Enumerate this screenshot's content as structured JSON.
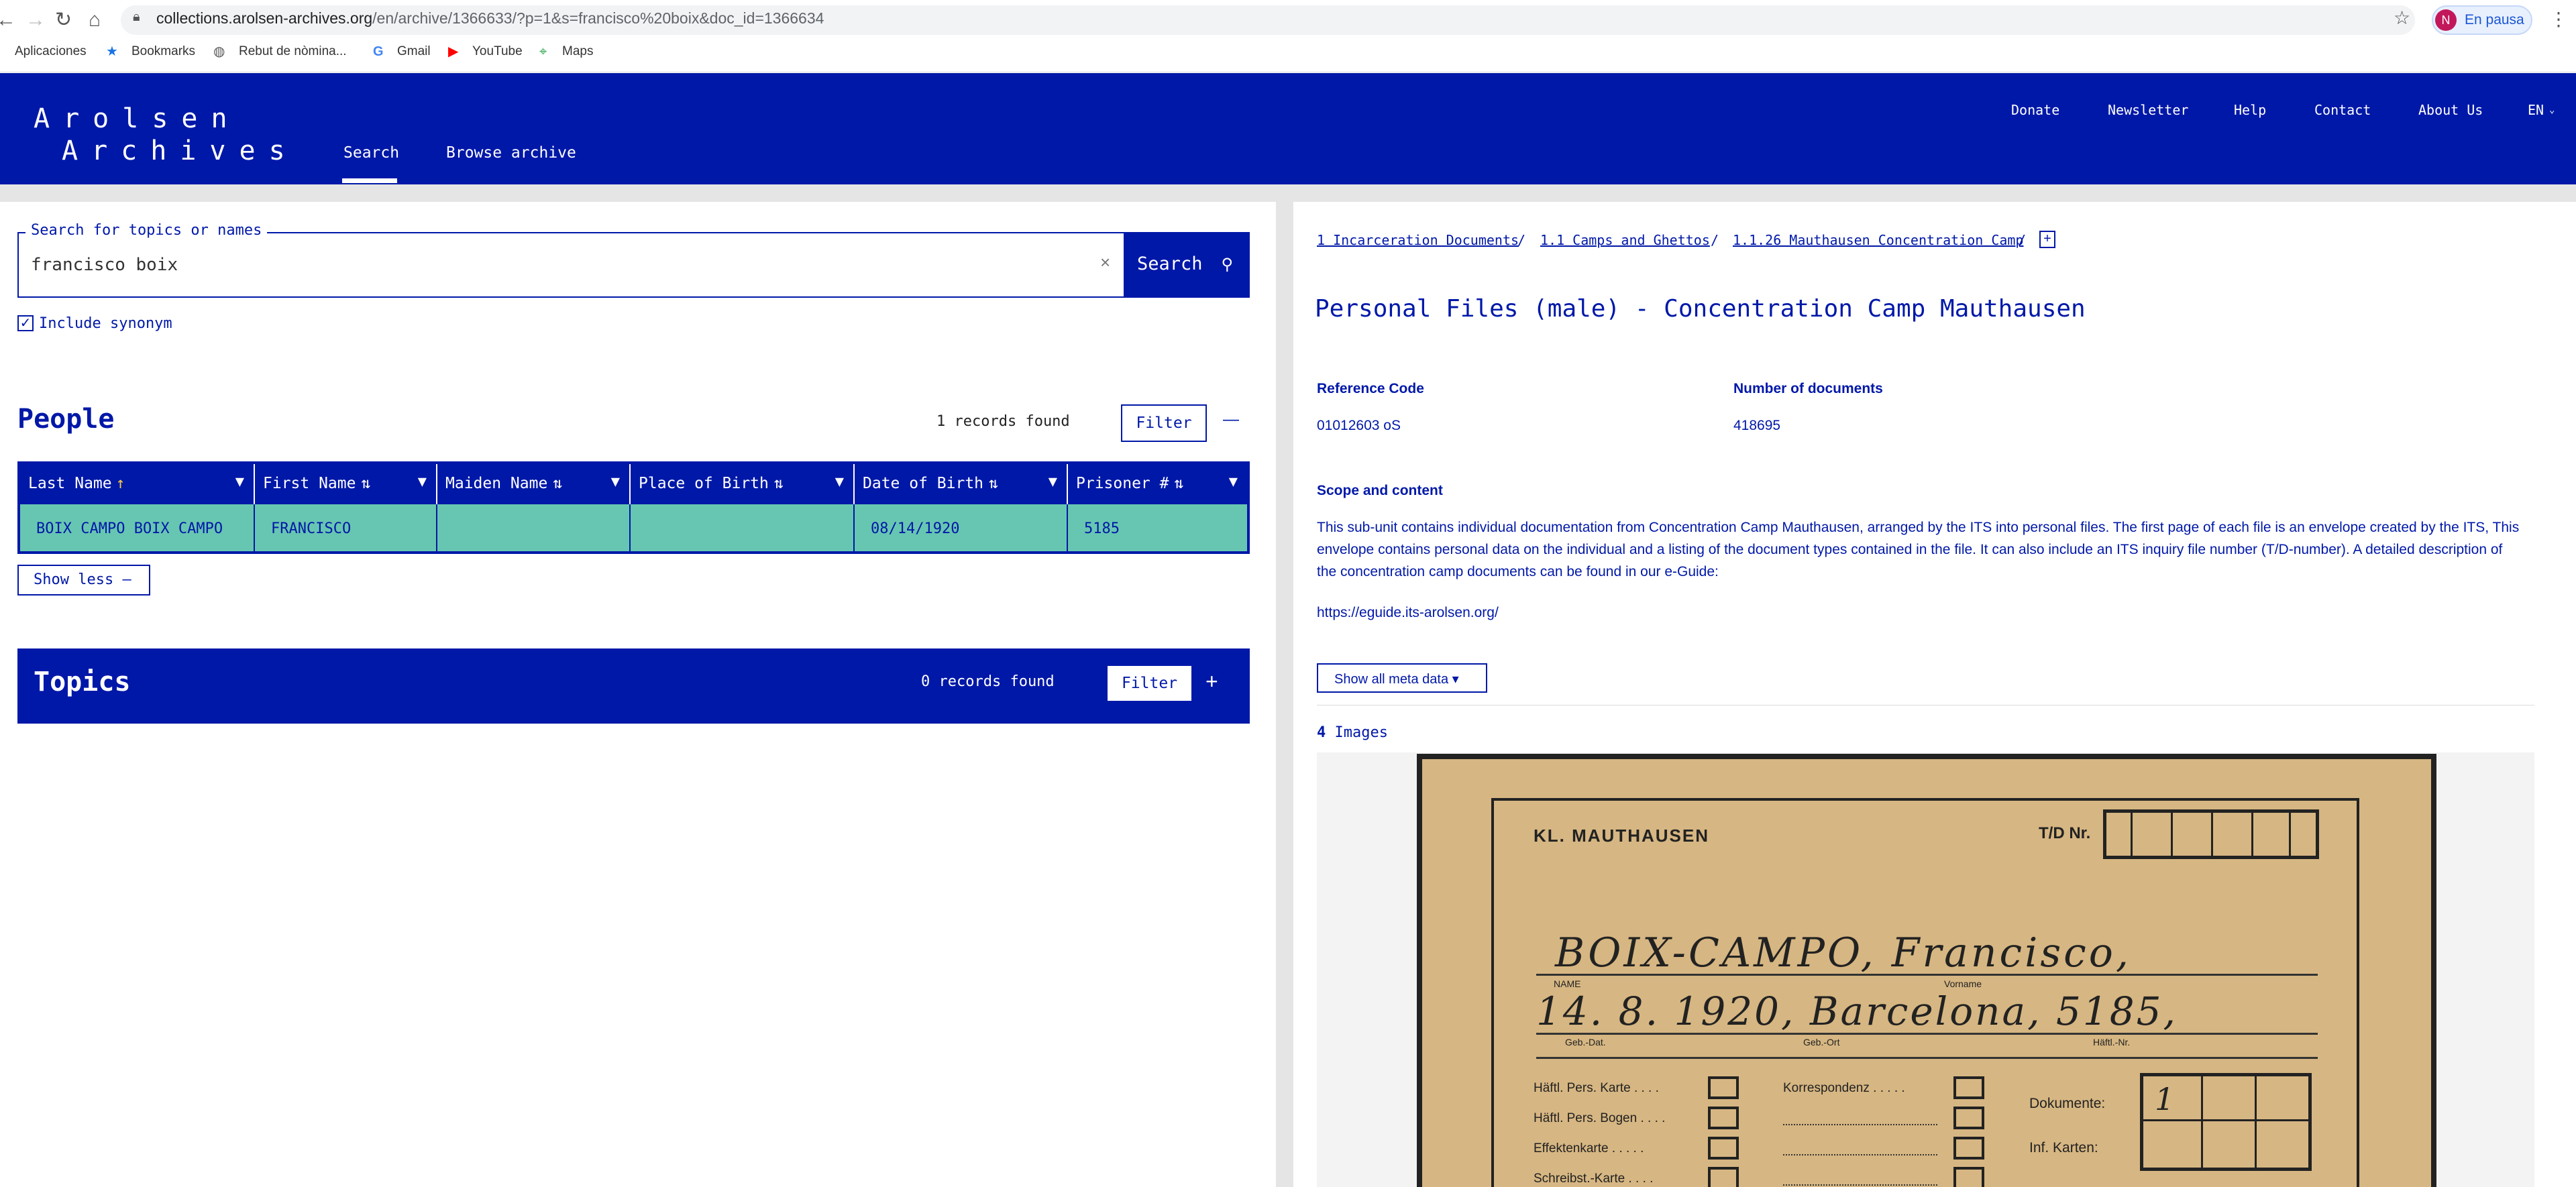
{
  "browser": {
    "url_domain": "collections.arolsen-archives.org",
    "url_path": "/en/archive/1366633/?p=1&s=francisco%20boix&doc_id=1366634",
    "profile_initial": "N",
    "profile_status": "En pausa",
    "bookmarks": [
      "Aplicaciones",
      "Bookmarks",
      "Rebut de nòmina...",
      "Gmail",
      "YouTube",
      "Maps"
    ]
  },
  "site": {
    "logo_line1": "Arolsen",
    "logo_line2": "Archives",
    "tabs": [
      "Search",
      "Browse archive"
    ],
    "top_nav": [
      "Donate",
      "Newsletter",
      "Help",
      "Contact",
      "About Us",
      "EN"
    ]
  },
  "search": {
    "legend": "Search for topics or names",
    "value": "francisco boix",
    "button": "Search",
    "synonym_label": "Include synonym",
    "synonym_checked": true
  },
  "people": {
    "title": "People",
    "count": "1 records found",
    "filter": "Filter",
    "collapse": "—",
    "columns": [
      "Last Name",
      "First Name",
      "Maiden Name",
      "Place of Birth",
      "Date of Birth",
      "Prisoner #"
    ],
    "rows": [
      [
        "BOIX CAMPO BOIX CAMPO",
        "FRANCISCO",
        "",
        "",
        "08/14/1920",
        "5185"
      ]
    ],
    "show_less": "Show less —"
  },
  "topics": {
    "title": "Topics",
    "count": "0 records found",
    "filter": "Filter",
    "expand": "+"
  },
  "record": {
    "breadcrumbs": [
      "1 Incarceration Documents",
      "1.1 Camps and Ghettos",
      "1.1.26 Mauthausen Concentration Camp"
    ],
    "expand": "+",
    "title": "Personal Files (male) - Concentration Camp Mauthausen",
    "ref_label": "Reference Code",
    "ref_value": "01012603 oS",
    "docs_label": "Number of documents",
    "docs_value": "418695",
    "scope_label": "Scope and content",
    "scope_text": "This sub-unit contains individual documentation from Concentration Camp Mauthausen, arranged by the ITS into personal files. The first page of each file is an envelope created by the ITS, This envelope contains personal data on the individual and a listing of the document types contained in the file. It can also include an ITS inquiry file number (T/D-number). A detailed description of the concentration camp documents can be found in our e-Guide:",
    "eguide_link": "https://eguide.its-arolsen.org/",
    "show_meta": "Show all meta data ▾",
    "images_count": "4",
    "images_label": "Images"
  },
  "document": {
    "camp": "KL. MAUTHAUSEN",
    "td_label": "T/D Nr.",
    "hand_line1": "BOIX-CAMPO, Francisco,",
    "hand_line2": "14. 8. 1920, Barcelona, 5185,",
    "label_name": "NAME",
    "label_vorname": "Vorname",
    "label_gebdat": "Geb.-Dat.",
    "label_gebort": "Geb.-Ort",
    "label_haeftl": "Häftl.-Nr.",
    "items_left": [
      "Häftl. Pers. Karte . . . .",
      "Häftl. Pers. Bogen . . . .",
      "Effektenkarte . . . . .",
      "Schreibst.-Karte . . . ."
    ],
    "items_right": [
      "Korrespondenz . . . . ."
    ],
    "dokumente_label": "Dokumente:",
    "dokumente_value": "1",
    "inf_karten_label": "Inf. Karten:"
  }
}
